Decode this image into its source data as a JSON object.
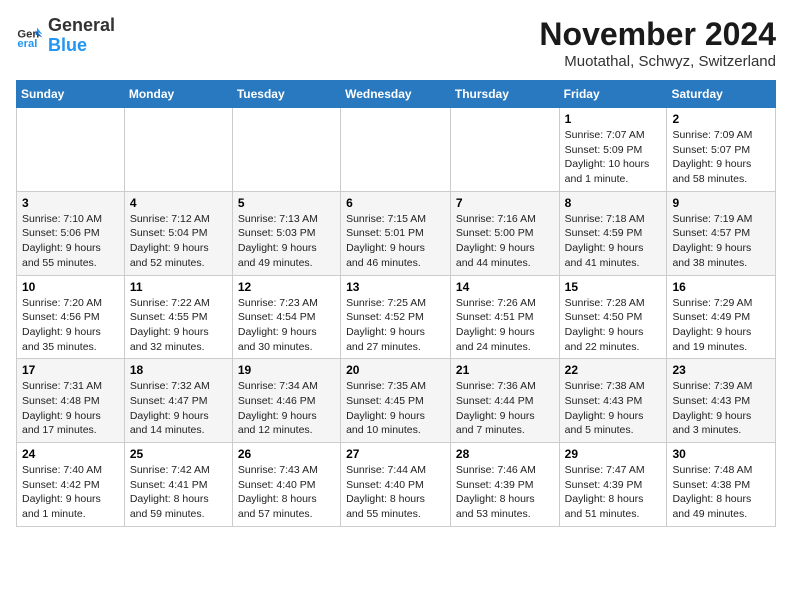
{
  "logo": {
    "line1": "General",
    "line2": "Blue"
  },
  "title": "November 2024",
  "location": "Muotathal, Schwyz, Switzerland",
  "weekdays": [
    "Sunday",
    "Monday",
    "Tuesday",
    "Wednesday",
    "Thursday",
    "Friday",
    "Saturday"
  ],
  "weeks": [
    [
      {
        "day": "",
        "info": ""
      },
      {
        "day": "",
        "info": ""
      },
      {
        "day": "",
        "info": ""
      },
      {
        "day": "",
        "info": ""
      },
      {
        "day": "",
        "info": ""
      },
      {
        "day": "1",
        "info": "Sunrise: 7:07 AM\nSunset: 5:09 PM\nDaylight: 10 hours and 1 minute."
      },
      {
        "day": "2",
        "info": "Sunrise: 7:09 AM\nSunset: 5:07 PM\nDaylight: 9 hours and 58 minutes."
      }
    ],
    [
      {
        "day": "3",
        "info": "Sunrise: 7:10 AM\nSunset: 5:06 PM\nDaylight: 9 hours and 55 minutes."
      },
      {
        "day": "4",
        "info": "Sunrise: 7:12 AM\nSunset: 5:04 PM\nDaylight: 9 hours and 52 minutes."
      },
      {
        "day": "5",
        "info": "Sunrise: 7:13 AM\nSunset: 5:03 PM\nDaylight: 9 hours and 49 minutes."
      },
      {
        "day": "6",
        "info": "Sunrise: 7:15 AM\nSunset: 5:01 PM\nDaylight: 9 hours and 46 minutes."
      },
      {
        "day": "7",
        "info": "Sunrise: 7:16 AM\nSunset: 5:00 PM\nDaylight: 9 hours and 44 minutes."
      },
      {
        "day": "8",
        "info": "Sunrise: 7:18 AM\nSunset: 4:59 PM\nDaylight: 9 hours and 41 minutes."
      },
      {
        "day": "9",
        "info": "Sunrise: 7:19 AM\nSunset: 4:57 PM\nDaylight: 9 hours and 38 minutes."
      }
    ],
    [
      {
        "day": "10",
        "info": "Sunrise: 7:20 AM\nSunset: 4:56 PM\nDaylight: 9 hours and 35 minutes."
      },
      {
        "day": "11",
        "info": "Sunrise: 7:22 AM\nSunset: 4:55 PM\nDaylight: 9 hours and 32 minutes."
      },
      {
        "day": "12",
        "info": "Sunrise: 7:23 AM\nSunset: 4:54 PM\nDaylight: 9 hours and 30 minutes."
      },
      {
        "day": "13",
        "info": "Sunrise: 7:25 AM\nSunset: 4:52 PM\nDaylight: 9 hours and 27 minutes."
      },
      {
        "day": "14",
        "info": "Sunrise: 7:26 AM\nSunset: 4:51 PM\nDaylight: 9 hours and 24 minutes."
      },
      {
        "day": "15",
        "info": "Sunrise: 7:28 AM\nSunset: 4:50 PM\nDaylight: 9 hours and 22 minutes."
      },
      {
        "day": "16",
        "info": "Sunrise: 7:29 AM\nSunset: 4:49 PM\nDaylight: 9 hours and 19 minutes."
      }
    ],
    [
      {
        "day": "17",
        "info": "Sunrise: 7:31 AM\nSunset: 4:48 PM\nDaylight: 9 hours and 17 minutes."
      },
      {
        "day": "18",
        "info": "Sunrise: 7:32 AM\nSunset: 4:47 PM\nDaylight: 9 hours and 14 minutes."
      },
      {
        "day": "19",
        "info": "Sunrise: 7:34 AM\nSunset: 4:46 PM\nDaylight: 9 hours and 12 minutes."
      },
      {
        "day": "20",
        "info": "Sunrise: 7:35 AM\nSunset: 4:45 PM\nDaylight: 9 hours and 10 minutes."
      },
      {
        "day": "21",
        "info": "Sunrise: 7:36 AM\nSunset: 4:44 PM\nDaylight: 9 hours and 7 minutes."
      },
      {
        "day": "22",
        "info": "Sunrise: 7:38 AM\nSunset: 4:43 PM\nDaylight: 9 hours and 5 minutes."
      },
      {
        "day": "23",
        "info": "Sunrise: 7:39 AM\nSunset: 4:43 PM\nDaylight: 9 hours and 3 minutes."
      }
    ],
    [
      {
        "day": "24",
        "info": "Sunrise: 7:40 AM\nSunset: 4:42 PM\nDaylight: 9 hours and 1 minute."
      },
      {
        "day": "25",
        "info": "Sunrise: 7:42 AM\nSunset: 4:41 PM\nDaylight: 8 hours and 59 minutes."
      },
      {
        "day": "26",
        "info": "Sunrise: 7:43 AM\nSunset: 4:40 PM\nDaylight: 8 hours and 57 minutes."
      },
      {
        "day": "27",
        "info": "Sunrise: 7:44 AM\nSunset: 4:40 PM\nDaylight: 8 hours and 55 minutes."
      },
      {
        "day": "28",
        "info": "Sunrise: 7:46 AM\nSunset: 4:39 PM\nDaylight: 8 hours and 53 minutes."
      },
      {
        "day": "29",
        "info": "Sunrise: 7:47 AM\nSunset: 4:39 PM\nDaylight: 8 hours and 51 minutes."
      },
      {
        "day": "30",
        "info": "Sunrise: 7:48 AM\nSunset: 4:38 PM\nDaylight: 8 hours and 49 minutes."
      }
    ]
  ]
}
